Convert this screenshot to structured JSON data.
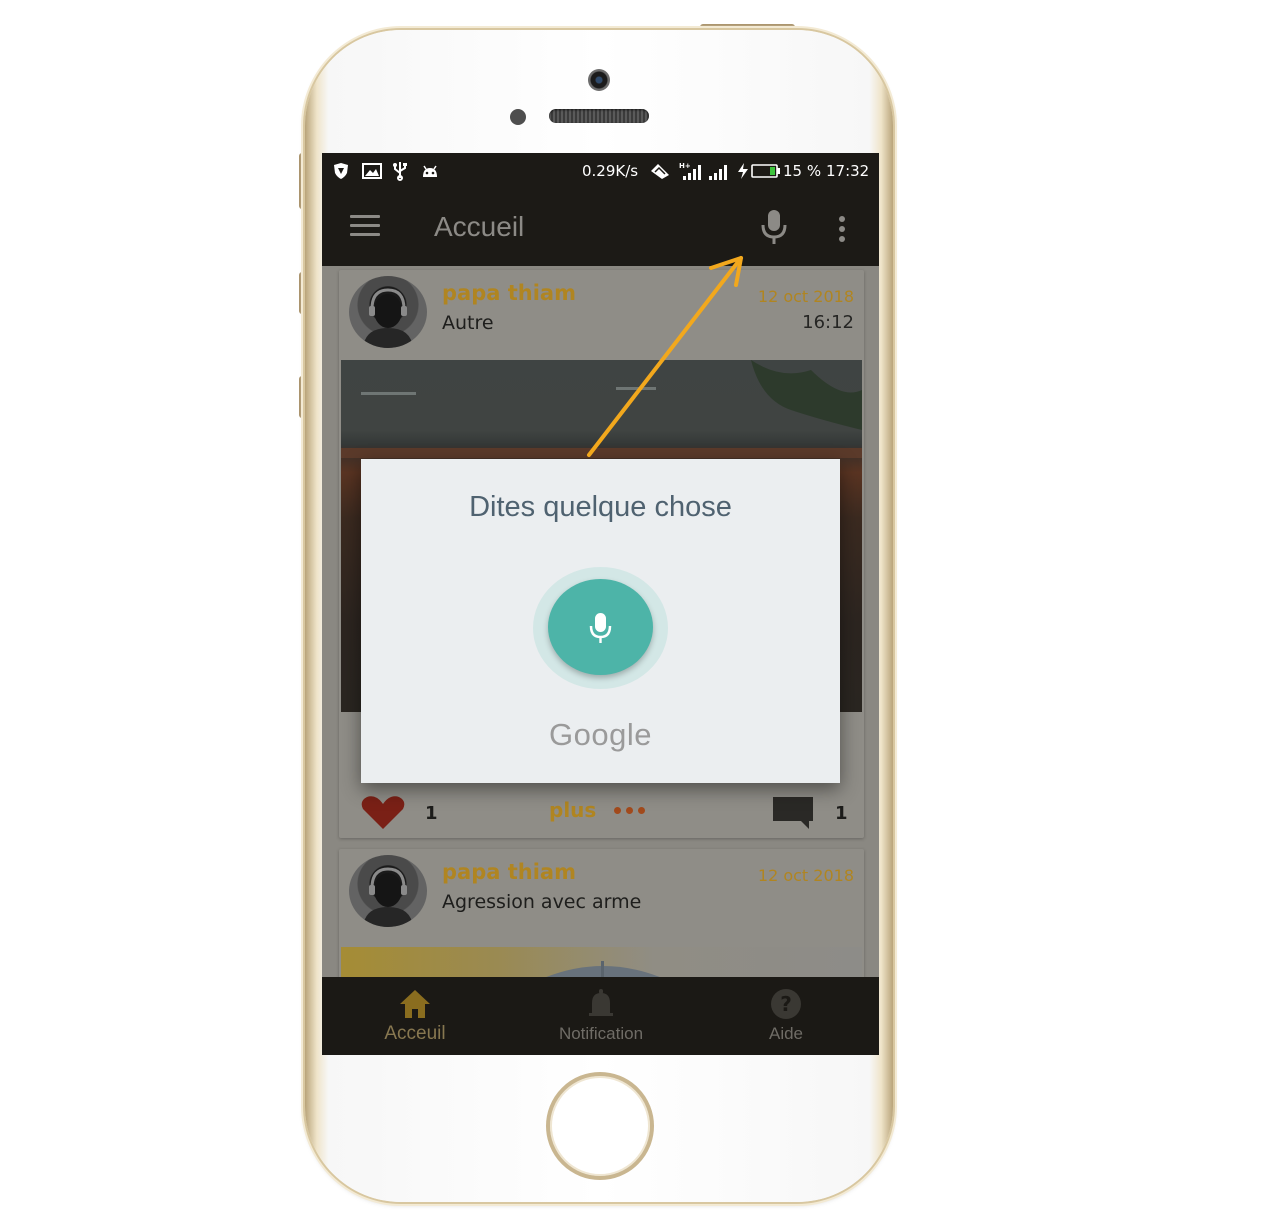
{
  "status_bar": {
    "speed": "0.29K/s",
    "network": "H+",
    "battery": "15 %",
    "time": "17:32"
  },
  "app_bar": {
    "title": "Accueil"
  },
  "posts": [
    {
      "author": "papa thiam",
      "category": "Autre",
      "date": "12 oct 2018",
      "time": "16:12"
    },
    {
      "author": "papa thiam",
      "category": "Agression avec arme",
      "date": "12 oct 2018"
    }
  ],
  "post_actions": {
    "like_count": "1",
    "more_label": "plus",
    "comment_count": "1"
  },
  "dialog": {
    "title": "Dites quelque chose",
    "brand": "Google"
  },
  "bottom_nav": [
    {
      "label": "Acceuil",
      "icon": "home-icon",
      "active": true
    },
    {
      "label": "Notification",
      "icon": "bell-icon",
      "active": false
    },
    {
      "label": "Aide",
      "icon": "help-icon",
      "active": false
    }
  ],
  "colors": {
    "accent": "#b08521",
    "voice_button": "#4db4a8",
    "arrow": "#f2a81d",
    "app_bar": "#1c1a16"
  }
}
